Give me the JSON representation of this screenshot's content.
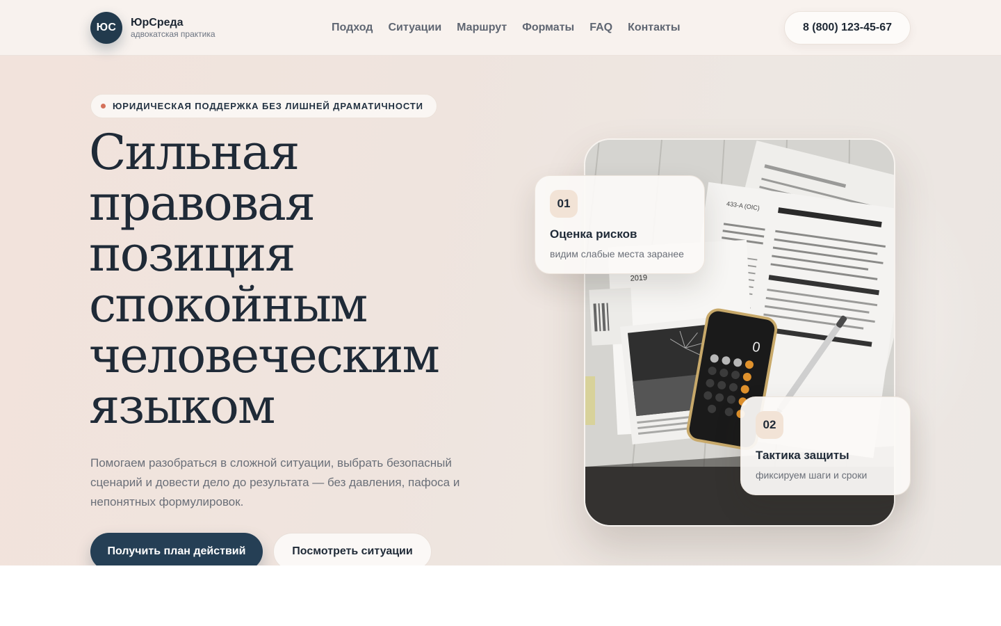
{
  "header": {
    "logo_mark": "ЮС",
    "brand_name": "ЮрСреда",
    "brand_sub": "адвокатская практика",
    "nav": [
      {
        "label": "Подход"
      },
      {
        "label": "Ситуации"
      },
      {
        "label": "Маршрут"
      },
      {
        "label": "Форматы"
      },
      {
        "label": "FAQ"
      },
      {
        "label": "Контакты"
      }
    ],
    "phone": "8 (800) 123-45-67"
  },
  "hero": {
    "eyebrow": "ЮРИДИЧЕСКАЯ ПОДДЕРЖКА БЕЗ ЛИШНЕЙ ДРАМАТИЧНОСТИ",
    "title_lines": [
      "Сильная",
      "правовая",
      "позиция",
      "спокойным",
      "человеческим",
      "языком"
    ],
    "description": "Помогаем разобраться в сложной ситуации, выбрать безопасный сценарий и довести дело до результата — без давления, пафоса и непонятных формулировок.",
    "primary_cta": "Получить план действий",
    "secondary_cta": "Посмотреть ситуации"
  },
  "photo": {
    "calculator_display": "0",
    "year_label": "2019",
    "form_number": "433-A (OIC)"
  },
  "cards": [
    {
      "num": "01",
      "title": "Оценка рисков",
      "subtitle": "видим слабые места заранее"
    },
    {
      "num": "02",
      "title": "Тактика защиты",
      "subtitle": "фиксируем шаги и сроки"
    }
  ],
  "colors": {
    "accent_dark": "#253f55",
    "accent_dot": "#d4715a",
    "card_num_bg": "#f2e3d6"
  }
}
